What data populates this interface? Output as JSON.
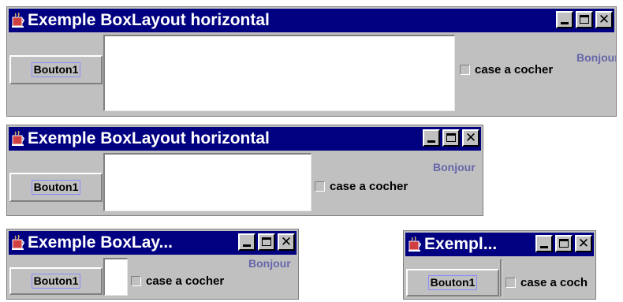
{
  "windows": [
    {
      "title": "Exemple BoxLayout horizontal",
      "button_label": "Bouton1",
      "checkbox_label": "case a cocher",
      "label_text": "Bonjour"
    },
    {
      "title": "Exemple BoxLayout horizontal",
      "button_label": "Bouton1",
      "checkbox_label": "case a cocher",
      "label_text": "Bonjour"
    },
    {
      "title": "Exemple BoxLay...",
      "button_label": "Bouton1",
      "checkbox_label": "case a cocher",
      "label_text": "Bonjour"
    },
    {
      "title": "Exempl...",
      "button_label": "Bouton1",
      "checkbox_label": "case a coch"
    }
  ],
  "icons": {
    "app": "java-coffee-cup-icon",
    "minimize": "minimize-icon",
    "maximize": "maximize-icon",
    "close": "close-icon"
  },
  "colors": {
    "titlebar": "#000080",
    "window_bg": "#c0c0c0",
    "label_text": "#6666aa"
  }
}
